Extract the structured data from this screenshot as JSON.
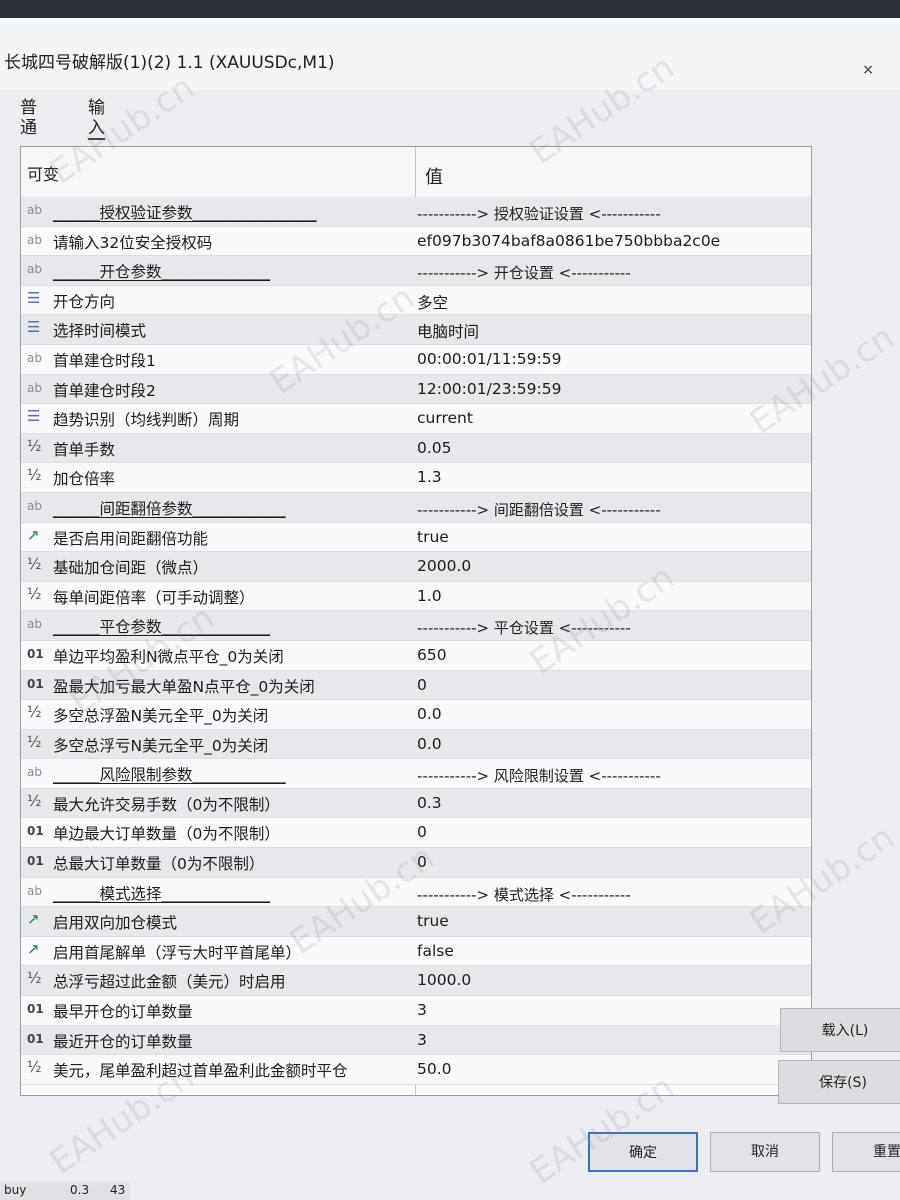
{
  "window": {
    "title": "长城四号破解版(1)(2) 1.1 (XAUUSDc,M1)",
    "close_symbol": "×"
  },
  "tabs": [
    {
      "label": "普通"
    },
    {
      "label": "输入"
    }
  ],
  "grid": {
    "header": {
      "name": "可变",
      "value": "值"
    },
    "rows": [
      {
        "icon": "ab",
        "icon_name": "string-type-icon",
        "name": "______授权验证参数________________",
        "value": "-----------> 授权验证设置 <-----------",
        "section": true
      },
      {
        "icon": "ab",
        "icon_name": "string-type-icon",
        "name": "请输入32位安全授权码",
        "value": "ef097b3074baf8a0861be750bbba2c0e",
        "section": false
      },
      {
        "icon": "ab",
        "icon_name": "string-type-icon",
        "name": "______开仓参数______________",
        "value": "-----------> 开仓设置 <-----------",
        "section": true
      },
      {
        "icon": "☰",
        "icon_name": "enum-list-icon",
        "name": "开仓方向",
        "value": "多空",
        "section": false
      },
      {
        "icon": "☰",
        "icon_name": "enum-list-icon",
        "name": "选择时间模式",
        "value": "电脑时间",
        "section": false
      },
      {
        "icon": "ab",
        "icon_name": "string-type-icon",
        "name": "首单建仓时段1",
        "value": "00:00:01/11:59:59",
        "section": false
      },
      {
        "icon": "ab",
        "icon_name": "string-type-icon",
        "name": "首单建仓时段2",
        "value": "12:00:01/23:59:59",
        "section": false
      },
      {
        "icon": "☰",
        "icon_name": "enum-list-icon",
        "name": "趋势识别（均线判断）周期",
        "value": "current",
        "section": false
      },
      {
        "icon": "½",
        "icon_name": "double-type-icon",
        "name": "首单手数",
        "value": "0.05",
        "section": false
      },
      {
        "icon": "½",
        "icon_name": "double-type-icon",
        "name": "加仓倍率",
        "value": "1.3",
        "section": false
      },
      {
        "icon": "ab",
        "icon_name": "string-type-icon",
        "name": "______间距翻倍参数____________",
        "value": "-----------> 间距翻倍设置 <-----------",
        "section": true
      },
      {
        "icon": "↗",
        "icon_name": "bool-type-icon",
        "name": "是否启用间距翻倍功能",
        "value": "true",
        "section": false
      },
      {
        "icon": "½",
        "icon_name": "double-type-icon",
        "name": "基础加仓间距（微点）",
        "value": "2000.0",
        "section": false
      },
      {
        "icon": "½",
        "icon_name": "double-type-icon",
        "name": "每单间距倍率（可手动调整）",
        "value": "1.0",
        "section": false
      },
      {
        "icon": "ab",
        "icon_name": "string-type-icon",
        "name": "______平仓参数______________",
        "value": "-----------> 平仓设置 <-----------",
        "section": true
      },
      {
        "icon": "01",
        "icon_name": "int-type-icon",
        "name": "单边平均盈利N微点平仓_0为关闭",
        "value": "650",
        "section": false
      },
      {
        "icon": "01",
        "icon_name": "int-type-icon",
        "name": "盈最大加亏最大单盈N点平仓_0为关闭",
        "value": "0",
        "section": false
      },
      {
        "icon": "½",
        "icon_name": "double-type-icon",
        "name": "多空总浮盈N美元全平_0为关闭",
        "value": "0.0",
        "section": false
      },
      {
        "icon": "½",
        "icon_name": "double-type-icon",
        "name": "多空总浮亏N美元全平_0为关闭",
        "value": "0.0",
        "section": false
      },
      {
        "icon": "ab",
        "icon_name": "string-type-icon",
        "name": "______风险限制参数____________",
        "value": "-----------> 风险限制设置 <-----------",
        "section": true
      },
      {
        "icon": "½",
        "icon_name": "double-type-icon",
        "name": "最大允许交易手数（0为不限制）",
        "value": "0.3",
        "section": false
      },
      {
        "icon": "01",
        "icon_name": "int-type-icon",
        "name": "单边最大订单数量（0为不限制）",
        "value": "0",
        "section": false
      },
      {
        "icon": "01",
        "icon_name": "int-type-icon",
        "name": "总最大订单数量（0为不限制）",
        "value": "0",
        "section": false
      },
      {
        "icon": "ab",
        "icon_name": "string-type-icon",
        "name": "______模式选择______________",
        "value": "-----------> 模式选择 <-----------",
        "section": true
      },
      {
        "icon": "↗",
        "icon_name": "bool-type-icon",
        "name": "启用双向加仓模式",
        "value": "true",
        "section": false
      },
      {
        "icon": "↗",
        "icon_name": "bool-type-icon",
        "name": "启用首尾解单（浮亏大时平首尾单）",
        "value": "false",
        "section": false
      },
      {
        "icon": "½",
        "icon_name": "double-type-icon",
        "name": "总浮亏超过此金额（美元）时启用",
        "value": "1000.0",
        "section": false
      },
      {
        "icon": "01",
        "icon_name": "int-type-icon",
        "name": "最早开仓的订单数量",
        "value": "3",
        "section": false
      },
      {
        "icon": "01",
        "icon_name": "int-type-icon",
        "name": "最近开仓的订单数量",
        "value": "3",
        "section": false
      },
      {
        "icon": "½",
        "icon_name": "double-type-icon",
        "name": "美元，尾单盈利超过首单盈利此金额时平仓",
        "value": "50.0",
        "section": false
      }
    ]
  },
  "buttons": {
    "load": "载入(L)",
    "save": "保存(S)",
    "ok": "确定",
    "cancel": "取消",
    "reset": "重置"
  },
  "taskbar": {
    "a": "buy",
    "b": "0.3",
    "c": "43"
  },
  "watermark": "EAHub.cn"
}
